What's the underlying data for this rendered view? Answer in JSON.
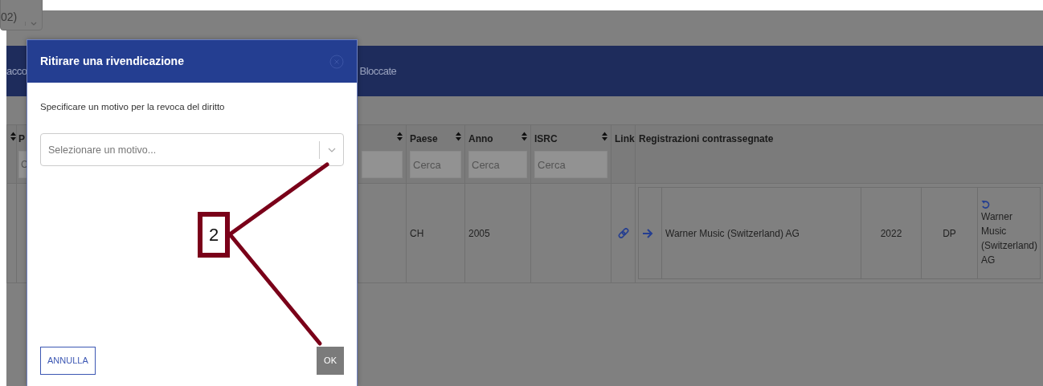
{
  "top_bar": {
    "selector_text": "02)"
  },
  "nav": {
    "tabs": [
      {
        "label": "acco"
      },
      {
        "label": "Bloccate"
      }
    ]
  },
  "table": {
    "columns": [
      {
        "sortable": true,
        "search": false
      },
      {
        "label": "P",
        "search": true,
        "placeholder": "C"
      },
      {
        "sortable": true,
        "search": true
      },
      {
        "label": "Paese",
        "sortable": true,
        "search": true,
        "placeholder": "Cerca"
      },
      {
        "label": "Anno",
        "sortable": true,
        "search": true,
        "placeholder": "Cerca"
      },
      {
        "label": "ISRC",
        "sortable": true,
        "search": true,
        "placeholder": "Cerca"
      },
      {
        "label": "Link",
        "sortable": false,
        "search": false
      },
      {
        "label": "Registrazioni contrassegnate",
        "sortable": false,
        "search": false
      }
    ],
    "rows": [
      {
        "paese": "CH",
        "anno": "2005",
        "link": true,
        "registrations": [
          {
            "name": "Warner Music (Switzerland) AG",
            "year": "2022",
            "type": "DP",
            "owner": "Warner Music (Switzerland) AG"
          }
        ]
      }
    ]
  },
  "modal": {
    "title": "Ritirare una rivendicazione",
    "close": true,
    "message": "Specificare un motivo per la revoca del diritto",
    "select": {
      "placeholder": "Selezionare un motivo..."
    },
    "buttons": [
      {
        "label": "ANNULLA",
        "kind": "outline"
      },
      {
        "label": "OK",
        "kind": "solid"
      }
    ]
  },
  "callout": {
    "label": "2"
  }
}
